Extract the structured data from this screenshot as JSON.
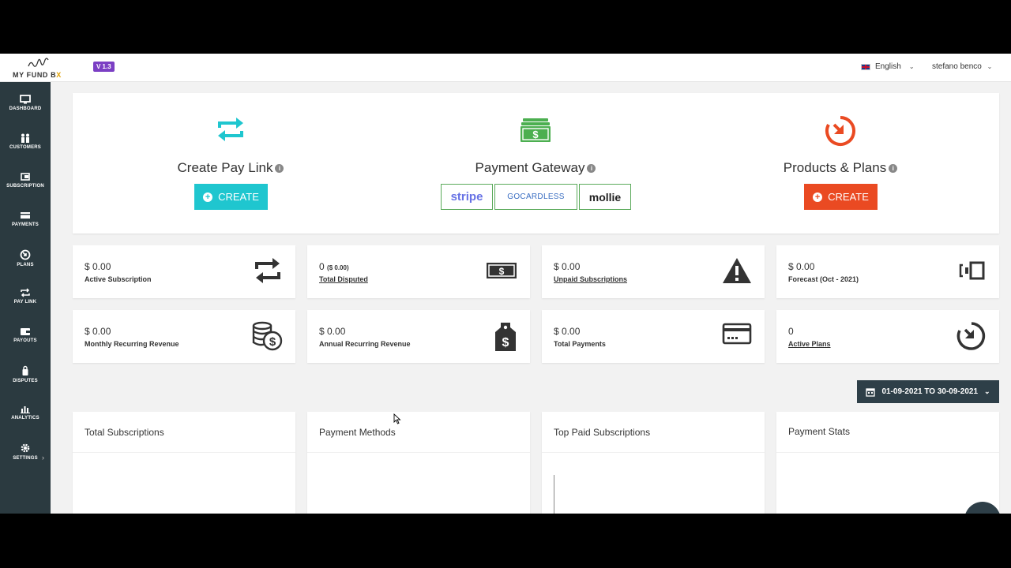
{
  "header": {
    "brand": "MY FUND B",
    "brand_suffix": "X",
    "version": "V 1.3",
    "language": "English",
    "user": "stefano benco"
  },
  "sidebar": {
    "items": [
      {
        "label": "DASHBOARD",
        "icon": "monitor-icon"
      },
      {
        "label": "CUSTOMERS",
        "icon": "users-icon"
      },
      {
        "label": "SUBSCRIPTION",
        "icon": "subscription-icon"
      },
      {
        "label": "PAYMENTS",
        "icon": "credit-card-icon"
      },
      {
        "label": "PLANS",
        "icon": "plans-icon"
      },
      {
        "label": "PAY LINK",
        "icon": "repeat-icon"
      },
      {
        "label": "PAYOUTS",
        "icon": "wallet-icon"
      },
      {
        "label": "DISPUTES",
        "icon": "lock-icon"
      },
      {
        "label": "ANALYTICS",
        "icon": "bar-chart-icon"
      },
      {
        "label": "SETTINGS",
        "icon": "gear-icon"
      }
    ]
  },
  "hero": {
    "paylink_title": "Create Pay Link",
    "paylink_button": "CREATE",
    "gateway_title": "Payment Gateway",
    "gateways": [
      "stripe",
      "GOCARDLESS",
      "mollie"
    ],
    "products_title": "Products & Plans",
    "products_button": "CREATE"
  },
  "stats": [
    {
      "value": "$ 0.00",
      "label": "Active Subscription",
      "icon": "repeat-icon",
      "link": false
    },
    {
      "value": "0",
      "value_extra": "($ 0.00)",
      "label": "Total Disputed",
      "icon": "cash-icon",
      "link": true
    },
    {
      "value": "$ 0.00",
      "label": "Unpaid Subscriptions",
      "icon": "warning-icon",
      "link": true
    },
    {
      "value": "$ 0.00",
      "label": "Forecast (Oct - 2021)",
      "icon": "forecast-icon",
      "link": false
    },
    {
      "value": "$ 0.00",
      "label": "Monthly Recurring Revenue",
      "icon": "coins-icon",
      "link": false
    },
    {
      "value": "$ 0.00",
      "label": "Annual Recurring Revenue",
      "icon": "price-tag-icon",
      "link": false
    },
    {
      "value": "$ 0.00",
      "label": "Total Payments",
      "icon": "credit-card-icon",
      "link": false
    },
    {
      "value": "0",
      "label": "Active Plans",
      "icon": "plans-icon",
      "link": true
    }
  ],
  "date_range": "01-09-2021 TO 30-09-2021",
  "panels": [
    "Total Subscriptions",
    "Payment Methods",
    "Top Paid Subscriptions",
    "Payment Stats"
  ],
  "colors": {
    "sidebar": "#2b3a40",
    "teal": "#1fc6cf",
    "green": "#4caf50",
    "orange_red": "#ea4a22",
    "version_badge": "#7b3fc4",
    "date_button": "#2e3f48"
  }
}
